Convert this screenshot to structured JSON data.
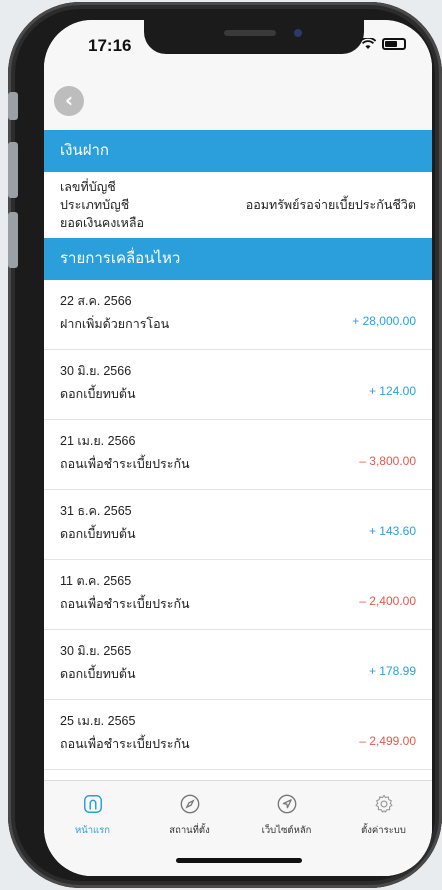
{
  "status": {
    "time": "17:16"
  },
  "sections": {
    "deposit_title": "เงินฝาก",
    "movement_title": "รายการเคลื่อนไหว"
  },
  "account": {
    "number_label": "เลขที่บัญชี",
    "type_label": "ประเภทบัญชี",
    "type_value": "ออมทรัพย์รอจ่ายเบี้ยประกันชีวิต",
    "balance_label": "ยอดเงินคงเหลือ"
  },
  "transactions": [
    {
      "date": "22 ส.ค. 2566",
      "desc": "ฝากเพิ่มด้วยการโอน",
      "amount": "+ 28,000.00",
      "type": "pos"
    },
    {
      "date": "30 มิ.ย. 2566",
      "desc": "ดอกเบี้ยทบต้น",
      "amount": "+ 124.00",
      "type": "pos"
    },
    {
      "date": "21 เม.ย. 2566",
      "desc": "ถอนเพื่อชำระเบี้ยประกัน",
      "amount": "– 3,800.00",
      "type": "neg"
    },
    {
      "date": "31 ธ.ค. 2565",
      "desc": "ดอกเบี้ยทบต้น",
      "amount": "+ 143.60",
      "type": "pos"
    },
    {
      "date": "11 ต.ค. 2565",
      "desc": "ถอนเพื่อชำระเบี้ยประกัน",
      "amount": "– 2,400.00",
      "type": "neg"
    },
    {
      "date": "30 มิ.ย. 2565",
      "desc": "ดอกเบี้ยทบต้น",
      "amount": "+ 178.99",
      "type": "pos"
    },
    {
      "date": "25 เม.ย. 2565",
      "desc": "ถอนเพื่อชำระเบี้ยประกัน",
      "amount": "– 2,499.00",
      "type": "neg"
    }
  ],
  "tabs": [
    {
      "label": "หน้าแรก",
      "icon": "home-icon",
      "active": true
    },
    {
      "label": "สถานที่ตั้ง",
      "icon": "compass-icon",
      "active": false
    },
    {
      "label": "เว็บไซต์หลัก",
      "icon": "navigation-icon",
      "active": false
    },
    {
      "label": "ตั้งค่าระบบ",
      "icon": "gear-icon",
      "active": false
    }
  ],
  "colors": {
    "accent": "#2b9fdc",
    "negative": "#e05a4a"
  }
}
